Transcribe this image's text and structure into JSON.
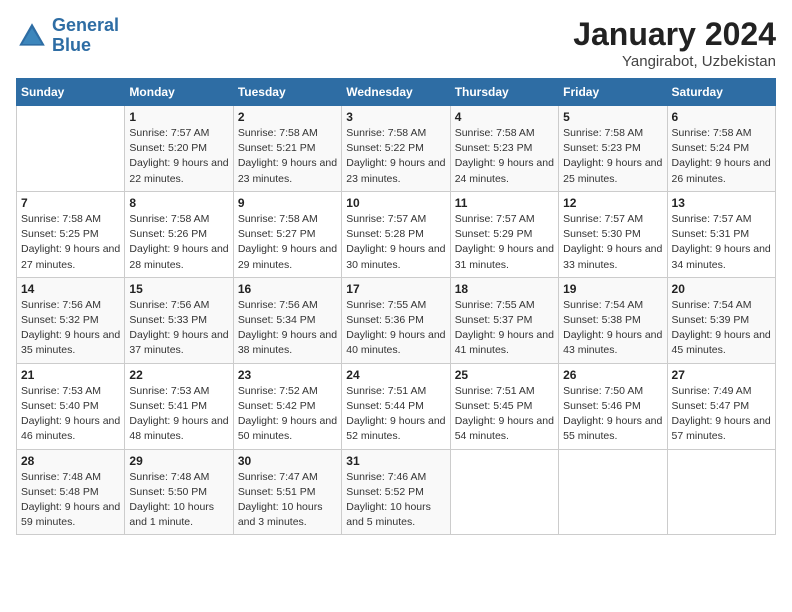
{
  "logo": {
    "line1": "General",
    "line2": "Blue"
  },
  "title": "January 2024",
  "location": "Yangirabot, Uzbekistan",
  "weekdays": [
    "Sunday",
    "Monday",
    "Tuesday",
    "Wednesday",
    "Thursday",
    "Friday",
    "Saturday"
  ],
  "weeks": [
    [
      {
        "day": "",
        "sunrise": "",
        "sunset": "",
        "daylight": ""
      },
      {
        "day": "1",
        "sunrise": "Sunrise: 7:57 AM",
        "sunset": "Sunset: 5:20 PM",
        "daylight": "Daylight: 9 hours and 22 minutes."
      },
      {
        "day": "2",
        "sunrise": "Sunrise: 7:58 AM",
        "sunset": "Sunset: 5:21 PM",
        "daylight": "Daylight: 9 hours and 23 minutes."
      },
      {
        "day": "3",
        "sunrise": "Sunrise: 7:58 AM",
        "sunset": "Sunset: 5:22 PM",
        "daylight": "Daylight: 9 hours and 23 minutes."
      },
      {
        "day": "4",
        "sunrise": "Sunrise: 7:58 AM",
        "sunset": "Sunset: 5:23 PM",
        "daylight": "Daylight: 9 hours and 24 minutes."
      },
      {
        "day": "5",
        "sunrise": "Sunrise: 7:58 AM",
        "sunset": "Sunset: 5:23 PM",
        "daylight": "Daylight: 9 hours and 25 minutes."
      },
      {
        "day": "6",
        "sunrise": "Sunrise: 7:58 AM",
        "sunset": "Sunset: 5:24 PM",
        "daylight": "Daylight: 9 hours and 26 minutes."
      }
    ],
    [
      {
        "day": "7",
        "sunrise": "Sunrise: 7:58 AM",
        "sunset": "Sunset: 5:25 PM",
        "daylight": "Daylight: 9 hours and 27 minutes."
      },
      {
        "day": "8",
        "sunrise": "Sunrise: 7:58 AM",
        "sunset": "Sunset: 5:26 PM",
        "daylight": "Daylight: 9 hours and 28 minutes."
      },
      {
        "day": "9",
        "sunrise": "Sunrise: 7:58 AM",
        "sunset": "Sunset: 5:27 PM",
        "daylight": "Daylight: 9 hours and 29 minutes."
      },
      {
        "day": "10",
        "sunrise": "Sunrise: 7:57 AM",
        "sunset": "Sunset: 5:28 PM",
        "daylight": "Daylight: 9 hours and 30 minutes."
      },
      {
        "day": "11",
        "sunrise": "Sunrise: 7:57 AM",
        "sunset": "Sunset: 5:29 PM",
        "daylight": "Daylight: 9 hours and 31 minutes."
      },
      {
        "day": "12",
        "sunrise": "Sunrise: 7:57 AM",
        "sunset": "Sunset: 5:30 PM",
        "daylight": "Daylight: 9 hours and 33 minutes."
      },
      {
        "day": "13",
        "sunrise": "Sunrise: 7:57 AM",
        "sunset": "Sunset: 5:31 PM",
        "daylight": "Daylight: 9 hours and 34 minutes."
      }
    ],
    [
      {
        "day": "14",
        "sunrise": "Sunrise: 7:56 AM",
        "sunset": "Sunset: 5:32 PM",
        "daylight": "Daylight: 9 hours and 35 minutes."
      },
      {
        "day": "15",
        "sunrise": "Sunrise: 7:56 AM",
        "sunset": "Sunset: 5:33 PM",
        "daylight": "Daylight: 9 hours and 37 minutes."
      },
      {
        "day": "16",
        "sunrise": "Sunrise: 7:56 AM",
        "sunset": "Sunset: 5:34 PM",
        "daylight": "Daylight: 9 hours and 38 minutes."
      },
      {
        "day": "17",
        "sunrise": "Sunrise: 7:55 AM",
        "sunset": "Sunset: 5:36 PM",
        "daylight": "Daylight: 9 hours and 40 minutes."
      },
      {
        "day": "18",
        "sunrise": "Sunrise: 7:55 AM",
        "sunset": "Sunset: 5:37 PM",
        "daylight": "Daylight: 9 hours and 41 minutes."
      },
      {
        "day": "19",
        "sunrise": "Sunrise: 7:54 AM",
        "sunset": "Sunset: 5:38 PM",
        "daylight": "Daylight: 9 hours and 43 minutes."
      },
      {
        "day": "20",
        "sunrise": "Sunrise: 7:54 AM",
        "sunset": "Sunset: 5:39 PM",
        "daylight": "Daylight: 9 hours and 45 minutes."
      }
    ],
    [
      {
        "day": "21",
        "sunrise": "Sunrise: 7:53 AM",
        "sunset": "Sunset: 5:40 PM",
        "daylight": "Daylight: 9 hours and 46 minutes."
      },
      {
        "day": "22",
        "sunrise": "Sunrise: 7:53 AM",
        "sunset": "Sunset: 5:41 PM",
        "daylight": "Daylight: 9 hours and 48 minutes."
      },
      {
        "day": "23",
        "sunrise": "Sunrise: 7:52 AM",
        "sunset": "Sunset: 5:42 PM",
        "daylight": "Daylight: 9 hours and 50 minutes."
      },
      {
        "day": "24",
        "sunrise": "Sunrise: 7:51 AM",
        "sunset": "Sunset: 5:44 PM",
        "daylight": "Daylight: 9 hours and 52 minutes."
      },
      {
        "day": "25",
        "sunrise": "Sunrise: 7:51 AM",
        "sunset": "Sunset: 5:45 PM",
        "daylight": "Daylight: 9 hours and 54 minutes."
      },
      {
        "day": "26",
        "sunrise": "Sunrise: 7:50 AM",
        "sunset": "Sunset: 5:46 PM",
        "daylight": "Daylight: 9 hours and 55 minutes."
      },
      {
        "day": "27",
        "sunrise": "Sunrise: 7:49 AM",
        "sunset": "Sunset: 5:47 PM",
        "daylight": "Daylight: 9 hours and 57 minutes."
      }
    ],
    [
      {
        "day": "28",
        "sunrise": "Sunrise: 7:48 AM",
        "sunset": "Sunset: 5:48 PM",
        "daylight": "Daylight: 9 hours and 59 minutes."
      },
      {
        "day": "29",
        "sunrise": "Sunrise: 7:48 AM",
        "sunset": "Sunset: 5:50 PM",
        "daylight": "Daylight: 10 hours and 1 minute."
      },
      {
        "day": "30",
        "sunrise": "Sunrise: 7:47 AM",
        "sunset": "Sunset: 5:51 PM",
        "daylight": "Daylight: 10 hours and 3 minutes."
      },
      {
        "day": "31",
        "sunrise": "Sunrise: 7:46 AM",
        "sunset": "Sunset: 5:52 PM",
        "daylight": "Daylight: 10 hours and 5 minutes."
      },
      {
        "day": "",
        "sunrise": "",
        "sunset": "",
        "daylight": ""
      },
      {
        "day": "",
        "sunrise": "",
        "sunset": "",
        "daylight": ""
      },
      {
        "day": "",
        "sunrise": "",
        "sunset": "",
        "daylight": ""
      }
    ]
  ]
}
